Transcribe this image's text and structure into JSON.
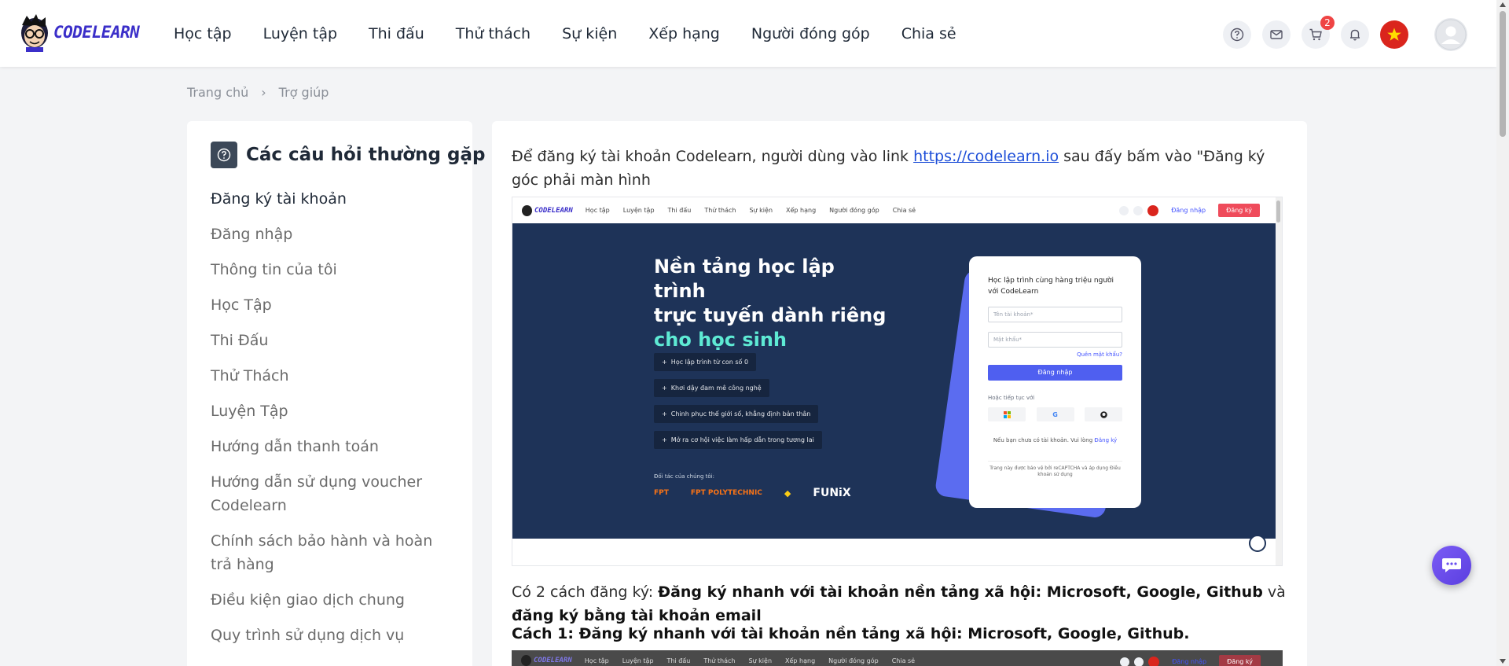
{
  "brand": {
    "logo_text": "CODELEARN"
  },
  "nav": {
    "items": [
      "Học tập",
      "Luyện tập",
      "Thi đấu",
      "Thử thách",
      "Sự kiện",
      "Xếp hạng",
      "Người đóng góp",
      "Chia sẻ"
    ],
    "icons": [
      "help-icon",
      "mail-icon",
      "cart-icon",
      "bell-icon"
    ],
    "cart_badge": "2"
  },
  "breadcrumb": {
    "home": "Trang chủ",
    "current": "Trợ giúp"
  },
  "sidebar": {
    "title": "Các câu hỏi thường gặp",
    "items": [
      "Đăng ký tài khoản",
      "Đăng nhập",
      "Thông tin của tôi",
      "Học Tập",
      "Thi Đấu",
      "Thử Thách",
      "Luyện Tập",
      "Hướng dẫn thanh toán",
      "Hướng dẫn sử dụng voucher Codelearn",
      "Chính sách bảo hành và hoàn trả hàng",
      "Điều kiện giao dịch chung",
      "Quy trình sử dụng dịch vụ"
    ]
  },
  "content": {
    "intro_before_link": "Để đăng ký tài khoản Codelearn, người dùng vào link ",
    "intro_link": "https://codelearn.io",
    "intro_after_link": " sau đấy bấm vào \"Đăng ký góc phải màn hình",
    "ways_prefix": "Có 2 cách đăng ký:  ",
    "ways_bold1": "Đăng ký nhanh với tài khoản nền tảng xã hội: Microsoft, Google, Github",
    "ways_mid": " và ",
    "ways_bold2": "đăng ký bằng tài khoản email",
    "method1": "Cách 1: Đăng ký nhanh với tài khoản nền tảng xã hội: Microsoft, Google, Github."
  },
  "screenshot": {
    "logo": "CODELEARN",
    "menu": [
      "Học tập",
      "Luyện tập",
      "Thi đấu",
      "Thử thách",
      "Sự kiện",
      "Xếp hạng",
      "Người đóng góp",
      "Chia sẻ"
    ],
    "login": "Đăng nhập",
    "register": "Đăng ký",
    "hero_line1": "Nền tảng học lập trình",
    "hero_line2": "trực tuyến dành riêng",
    "hero_line3": "cho học sinh",
    "pills": [
      "Học lập trình từ con số 0",
      "Khơi dậy đam mê công nghệ",
      "Chinh phục thế giới số, khẳng định bản thân",
      "Mở ra cơ hội việc làm hấp dẫn trong tương lai"
    ],
    "partners_label": "Đối tác của chúng tôi:",
    "partners": [
      "FPT",
      "FPT POLYTECHNIC",
      "◆",
      "FUNiX"
    ],
    "card_title": "Học lập trình cùng hàng triệu người với CodeLearn",
    "username_placeholder": "Tên tài khoản*",
    "password_placeholder": "Mật khẩu*",
    "forgot": "Quên mật khẩu?",
    "login_button": "Đăng nhập",
    "or_continue": "Hoặc tiếp tục với",
    "no_account": "Nếu bạn chưa có tài khoản. Vui lòng ",
    "register_link": "Đăng ký",
    "captcha": "Trang này được bảo vệ bởi reCAPTCHA và áp dụng Điều khoản sử dụng"
  },
  "colors": {
    "brand": "#3b2fc9",
    "hero_bg": "#1e3358",
    "accent_teal": "#5eead4",
    "primary_button": "#4f5ff0",
    "register_red": "#ef4b5b"
  }
}
